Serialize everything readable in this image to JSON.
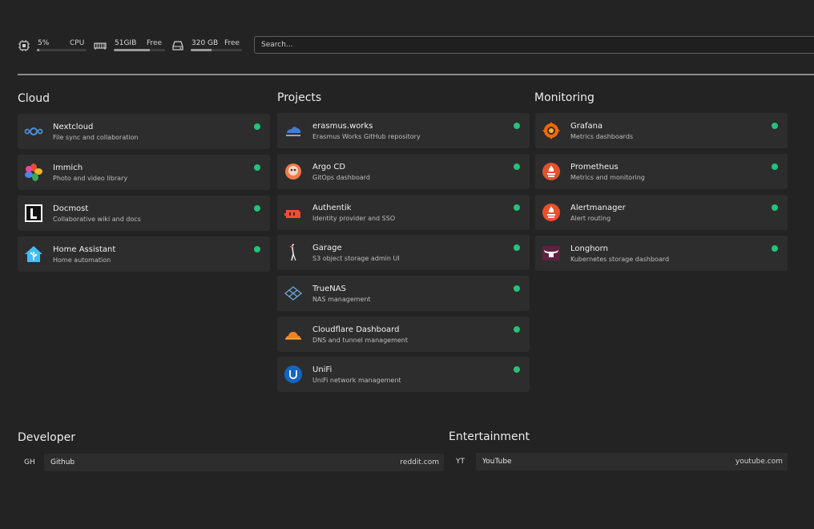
{
  "stats": {
    "cpu": {
      "value": "5%",
      "label": "CPU",
      "fraction": 0.05
    },
    "ram": {
      "value": "51GIB",
      "label": "Free",
      "fraction": 0.7
    },
    "disk": {
      "value": "320 GB",
      "label": "Free",
      "fraction": 0.4
    }
  },
  "search": {
    "placeholder": "Search..."
  },
  "sections": {
    "cloud": {
      "title": "Cloud",
      "items": [
        {
          "name": "Nextcloud",
          "desc": "File sync and collaboration",
          "icon": "nextcloud-icon"
        },
        {
          "name": "Immich",
          "desc": "Photo and video library",
          "icon": "immich-icon"
        },
        {
          "name": "Docmost",
          "desc": "Collaborative wiki and docs",
          "icon": "docmost-icon"
        },
        {
          "name": "Home Assistant",
          "desc": "Home automation",
          "icon": "home-assistant-icon"
        }
      ]
    },
    "projects": {
      "title": "Projects",
      "items": [
        {
          "name": "erasmus.works",
          "desc": "Erasmus Works GitHub repository",
          "icon": "erasmus-icon"
        },
        {
          "name": "Argo CD",
          "desc": "GitOps dashboard",
          "icon": "argo-icon"
        },
        {
          "name": "Authentik",
          "desc": "Identity provider and SSO",
          "icon": "authentik-icon"
        },
        {
          "name": "Garage",
          "desc": "S3 object storage admin UI",
          "icon": "garage-icon"
        },
        {
          "name": "TrueNAS",
          "desc": "NAS management",
          "icon": "truenas-icon"
        },
        {
          "name": "Cloudflare Dashboard",
          "desc": "DNS and tunnel management",
          "icon": "cloudflare-icon"
        },
        {
          "name": "UniFi",
          "desc": "UniFi network management",
          "icon": "unifi-icon"
        }
      ]
    },
    "monitoring": {
      "title": "Monitoring",
      "items": [
        {
          "name": "Grafana",
          "desc": "Metrics dashboards",
          "icon": "grafana-icon"
        },
        {
          "name": "Prometheus",
          "desc": "Metrics and monitoring",
          "icon": "prometheus-icon"
        },
        {
          "name": "Alertmanager",
          "desc": "Alert routing",
          "icon": "alertmanager-icon"
        },
        {
          "name": "Longhorn",
          "desc": "Kubernetes storage dashboard",
          "icon": "longhorn-icon"
        }
      ]
    }
  },
  "bookmarks": {
    "developer": {
      "title": "Developer",
      "items": [
        {
          "abbr": "GH",
          "name": "Github",
          "url": "reddit.com"
        }
      ]
    },
    "entertainment": {
      "title": "Entertainment",
      "items": [
        {
          "abbr": "YT",
          "name": "YouTube",
          "url": "youtube.com"
        }
      ]
    }
  },
  "colors": {
    "status_up": "#22c37a",
    "card_bg": "#2d2d2d",
    "page_bg": "#232323"
  }
}
